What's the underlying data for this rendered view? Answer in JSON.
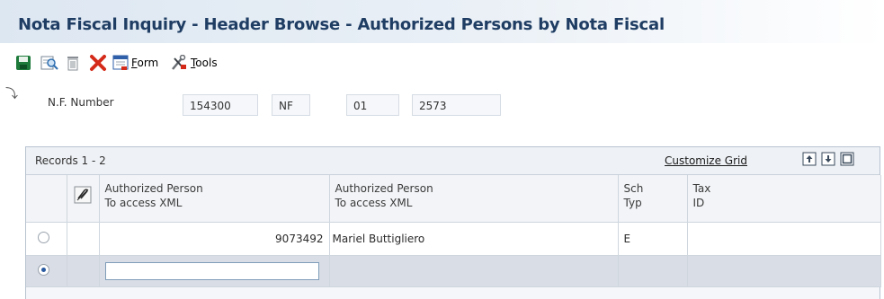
{
  "title": "Nota Fiscal Inquiry - Header Browse - Authorized Persons by Nota Fiscal",
  "toolbar": {
    "save_icon": "save-icon",
    "find_icon": "find-icon",
    "delete_icon": "trash-icon",
    "cancel_icon": "close-icon",
    "form_label_first": "F",
    "form_label_rest": "orm",
    "tools_label_first": "T",
    "tools_label_rest": "ools"
  },
  "header": {
    "nf_label": "N.F. Number",
    "nf_number": "154300",
    "nf_type": "NF",
    "nf_series": "01",
    "nf_extra": "2573"
  },
  "grid": {
    "records": "Records 1 - 2",
    "customize": "Customize Grid",
    "columns": [
      {
        "line1": "Authorized Person",
        "line2": "To access XML"
      },
      {
        "line1": "Authorized Person",
        "line2": "To access XML"
      },
      {
        "line1": "Sch",
        "line2": "Typ"
      },
      {
        "line1": "Tax",
        "line2": "ID"
      }
    ],
    "rows": [
      {
        "person_number": "9073492",
        "person_name": "Mariel Buttigliero",
        "sch_typ": "E",
        "tax_id": ""
      }
    ]
  },
  "colors": {
    "title": "#1f3d63",
    "selected_row": "#d9dee6",
    "delete_red": "#d42a1a"
  }
}
